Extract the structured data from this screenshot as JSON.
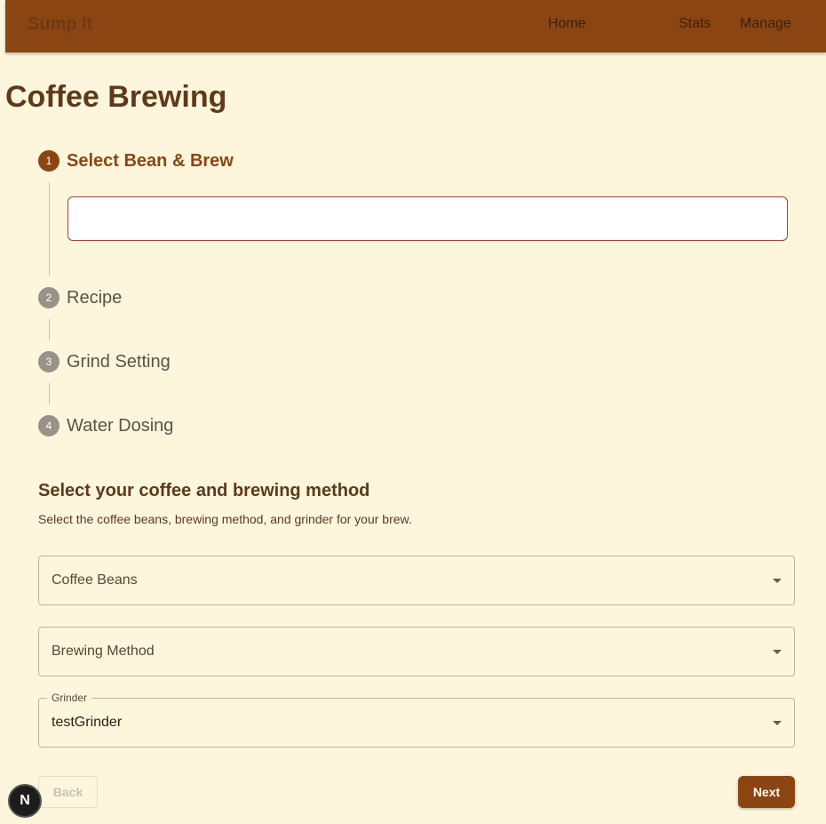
{
  "navbar": {
    "brand": "Sump It",
    "links": [
      "Home",
      "Stats",
      "Manage"
    ]
  },
  "page_title": "Coffee Brewing",
  "stepper": {
    "steps": [
      {
        "number": "1",
        "label": "Select Bean & Brew",
        "active": true
      },
      {
        "number": "2",
        "label": "Recipe",
        "active": false
      },
      {
        "number": "3",
        "label": "Grind Setting",
        "active": false
      },
      {
        "number": "4",
        "label": "Water Dosing",
        "active": false
      }
    ],
    "step_input_value": ""
  },
  "section": {
    "title": "Select your coffee and brewing method",
    "description": "Select the coffee beans, brewing method, and grinder for your brew."
  },
  "fields": {
    "coffee_beans": {
      "placeholder": "Coffee Beans",
      "value": ""
    },
    "brewing_method": {
      "placeholder": "Brewing Method",
      "value": ""
    },
    "grinder": {
      "label": "Grinder",
      "value": "testGrinder"
    }
  },
  "buttons": {
    "back": "Back",
    "next": "Next"
  },
  "dev_badge": "N",
  "colors": {
    "primary": "#8b4513",
    "background": "#fdf6dc",
    "inactive_step": "#9a9188"
  }
}
